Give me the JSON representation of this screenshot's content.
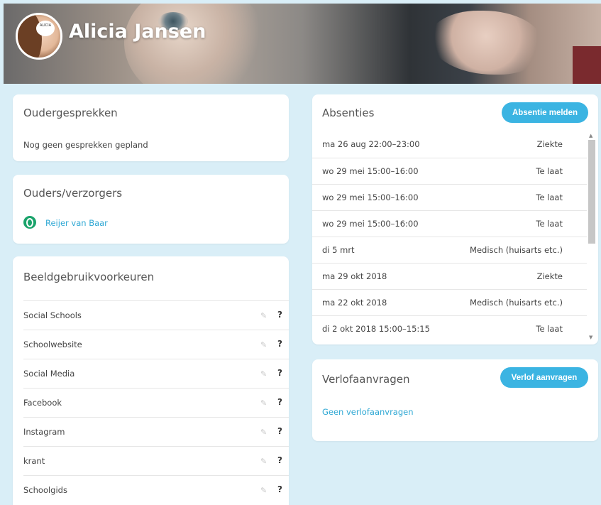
{
  "header": {
    "student_name": "Alicia Jansen",
    "avatar_text": "ALICIA"
  },
  "oudergesprekken": {
    "title": "Oudergesprekken",
    "empty_text": "Nog geen gesprekken gepland"
  },
  "ouders": {
    "title": "Ouders/verzorgers",
    "parents": [
      {
        "name": "Reijer van Baar",
        "icon": "parent-icon"
      }
    ]
  },
  "beeldgebruik": {
    "title": "Beeldgebruikvoorkeuren",
    "items": [
      {
        "label": "Social Schools",
        "edit_icon": "pencil-icon",
        "status": "?"
      },
      {
        "label": "Schoolwebsite",
        "edit_icon": "pencil-icon",
        "status": "?"
      },
      {
        "label": "Social Media",
        "edit_icon": "pencil-icon",
        "status": "?"
      },
      {
        "label": "Facebook",
        "edit_icon": "pencil-icon",
        "status": "?"
      },
      {
        "label": "Instagram",
        "edit_icon": "pencil-icon",
        "status": "?"
      },
      {
        "label": "krant",
        "edit_icon": "pencil-icon",
        "status": "?"
      },
      {
        "label": "Schoolgids",
        "edit_icon": "pencil-icon",
        "status": "?"
      }
    ]
  },
  "absenties": {
    "title": "Absenties",
    "button_label": "Absentie melden",
    "rows": [
      {
        "date": "ma 26 aug 22:00–23:00",
        "reason": "Ziekte"
      },
      {
        "date": "wo 29 mei 15:00–16:00",
        "reason": "Te laat"
      },
      {
        "date": "wo 29 mei 15:00–16:00",
        "reason": "Te laat"
      },
      {
        "date": "wo 29 mei 15:00–16:00",
        "reason": "Te laat"
      },
      {
        "date": "di 5 mrt",
        "reason": "Medisch (huisarts etc.)"
      },
      {
        "date": "ma 29 okt 2018",
        "reason": "Ziekte"
      },
      {
        "date": "ma 22 okt 2018",
        "reason": "Medisch (huisarts etc.)"
      },
      {
        "date": "di 2 okt 2018 15:00–15:15",
        "reason": "Te laat"
      }
    ]
  },
  "verlof": {
    "title": "Verlofaanvragen",
    "button_label": "Verlof aanvragen",
    "empty_text": "Geen verlofaanvragen"
  },
  "colors": {
    "background": "#d9eef7",
    "accent": "#3bb4e2",
    "parent_icon": "#1aa36b"
  }
}
